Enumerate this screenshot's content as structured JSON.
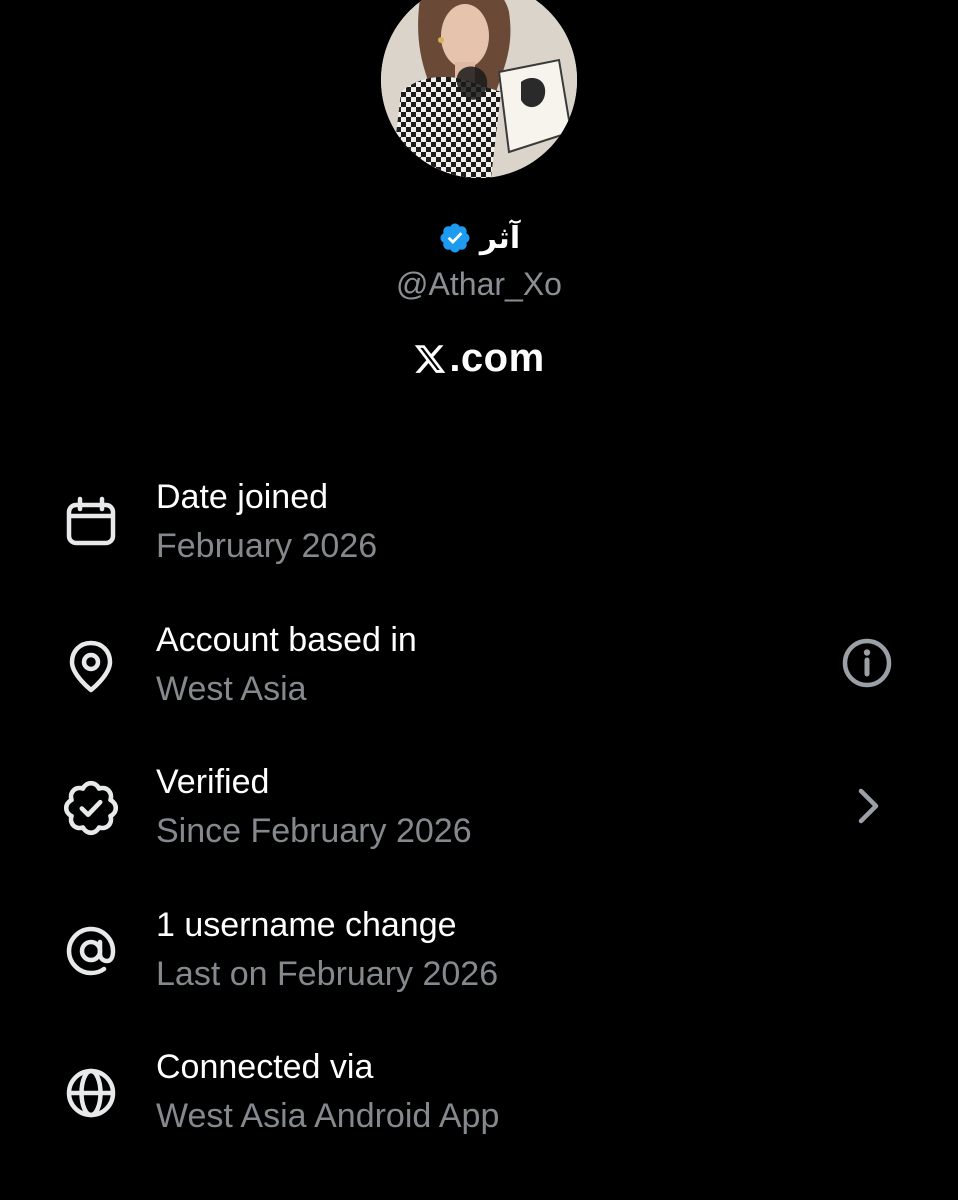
{
  "profile": {
    "display_name": "آثر",
    "handle": "@Athar_Xo",
    "verified_badge_color": "#1d9bf0"
  },
  "brand": {
    "domain_label": ".com"
  },
  "info_rows": [
    {
      "icon": "calendar-icon",
      "title": "Date joined",
      "subtitle": "February 2026"
    },
    {
      "icon": "location-pin-icon",
      "title": "Account based in",
      "subtitle": "West Asia",
      "action_icon": "info-icon"
    },
    {
      "icon": "verified-seal-icon",
      "title": "Verified",
      "subtitle": "Since February 2026",
      "action_icon": "chevron-right-icon"
    },
    {
      "icon": "at-sign-icon",
      "title": "1 username change",
      "subtitle": "Last on February 2026"
    },
    {
      "icon": "globe-icon",
      "title": "Connected via",
      "subtitle": "West Asia Android App"
    }
  ],
  "colors": {
    "background": "#000000",
    "primary_text": "#ffffff",
    "secondary_text": "#85898e",
    "accent": "#1d9bf0"
  }
}
